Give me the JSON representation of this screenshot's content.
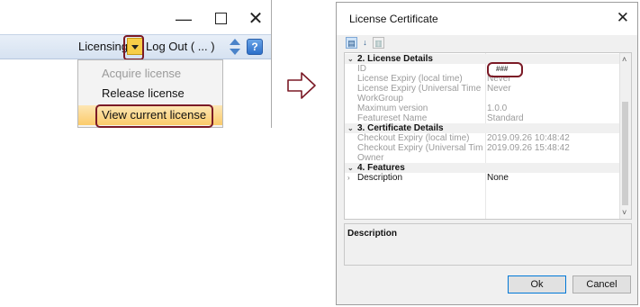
{
  "left_window": {
    "minimize_glyph": "—",
    "close_glyph": "✕",
    "toolbar": {
      "licensing_label": "Licensing",
      "logout_label": "Log Out ( ... )",
      "help_glyph": "?"
    },
    "menu": {
      "items": [
        {
          "label": "Acquire license",
          "enabled": false
        },
        {
          "label": "Release license",
          "enabled": true
        },
        {
          "label": "View current license",
          "enabled": true,
          "highlighted": true
        }
      ]
    }
  },
  "dialog": {
    "title": "License Certificate",
    "close_glyph": "✕",
    "toolbar_icons": [
      "categorized-icon",
      "alphabetical-icon",
      "property-pages-icon"
    ],
    "alpha_glyph": "↓",
    "property_grid": {
      "rows": [
        {
          "kind": "category",
          "label": "2. License Details",
          "expanded": true
        },
        {
          "kind": "property",
          "name": "ID",
          "value": "###"
        },
        {
          "kind": "property",
          "name": "License Expiry (local time)",
          "value": "Never"
        },
        {
          "kind": "property",
          "name": "License Expiry (Universal Time",
          "value": "Never"
        },
        {
          "kind": "property",
          "name": "WorkGroup",
          "value": ""
        },
        {
          "kind": "property",
          "name": "Maximum version",
          "value": "1.0.0"
        },
        {
          "kind": "property",
          "name": "Featureset Name",
          "value": "Standard"
        },
        {
          "kind": "category",
          "label": "3. Certificate Details",
          "expanded": true
        },
        {
          "kind": "property",
          "name": "Checkout Expiry (local time)",
          "value": "2019.09.26 10:48:42"
        },
        {
          "kind": "property",
          "name": "Checkout Expiry (Universal Tim",
          "value": "2019.09.26 15:48:42"
        },
        {
          "kind": "property",
          "name": "Owner",
          "value": ""
        },
        {
          "kind": "category",
          "label": "4. Features",
          "expanded": true
        },
        {
          "kind": "property",
          "name": "Description",
          "value": "None",
          "collapsed_child": true
        }
      ]
    },
    "description_panel": {
      "title": "Description"
    },
    "buttons": {
      "ok": "Ok",
      "cancel": "Cancel"
    }
  },
  "colors": {
    "highlight_outline": "#7b1a26",
    "dropdown_button": "#f7cd48",
    "menu_highlight": "#fbcb6a",
    "ribbon": "#d6e2f1"
  }
}
